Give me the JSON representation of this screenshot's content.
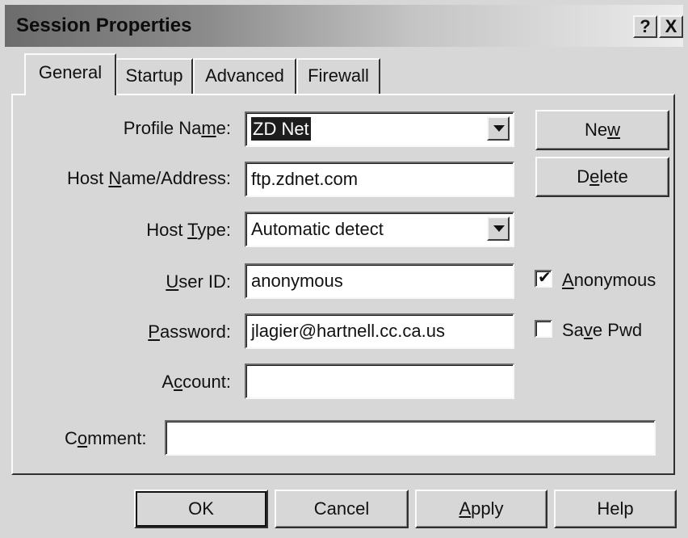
{
  "window": {
    "title": "Session Properties",
    "help_button": "?",
    "close_button": "X"
  },
  "tabs": [
    {
      "label": "General",
      "active": true
    },
    {
      "label": "Startup",
      "active": false
    },
    {
      "label": "Advanced",
      "active": false
    },
    {
      "label": "Firewall",
      "active": false
    }
  ],
  "form": {
    "profile_name": {
      "label_pre": "Profile Na",
      "label_u": "m",
      "label_post": "e:",
      "value": "ZD Net"
    },
    "host_name": {
      "label_pre": "Host ",
      "label_u": "N",
      "label_post": "ame/Address:",
      "value": "ftp.zdnet.com"
    },
    "host_type": {
      "label_pre": "Host ",
      "label_u": "T",
      "label_post": "ype:",
      "value": "Automatic detect"
    },
    "user_id": {
      "label_pre": "",
      "label_u": "U",
      "label_post": "ser ID:",
      "value": "anonymous"
    },
    "password": {
      "label_pre": "",
      "label_u": "P",
      "label_post": "assword:",
      "value": "jlagier@hartnell.cc.ca.us"
    },
    "account": {
      "label_pre": "A",
      "label_u": "c",
      "label_post": "count:",
      "value": ""
    },
    "comment": {
      "label_pre": "C",
      "label_u": "o",
      "label_post": "mment:",
      "value": ""
    }
  },
  "side_buttons": {
    "new": {
      "pre": "Ne",
      "u": "w",
      "post": ""
    },
    "delete": {
      "pre": "D",
      "u": "e",
      "post": "lete"
    }
  },
  "checkboxes": {
    "anonymous": {
      "pre": "",
      "u": "A",
      "post": "nonymous",
      "checked": true,
      "mark": "✔"
    },
    "save_pwd": {
      "pre": "Sa",
      "u": "v",
      "post": "e Pwd",
      "checked": false
    }
  },
  "footer_buttons": {
    "ok": "OK",
    "cancel": "Cancel",
    "apply": {
      "pre": "",
      "u": "A",
      "post": "pply"
    },
    "help": "Help"
  }
}
